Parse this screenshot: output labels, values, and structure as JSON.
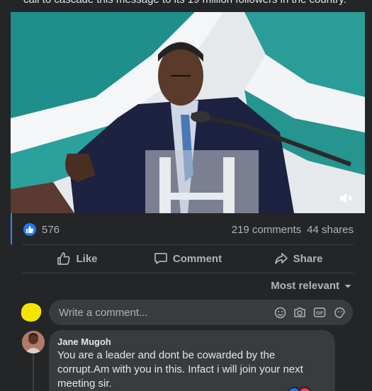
{
  "post": {
    "caption": "call to cascade this message to its 19 million followers in the country."
  },
  "stats": {
    "likes": "576",
    "comments": "219 comments",
    "shares": "44 shares"
  },
  "actions": {
    "like": "Like",
    "comment": "Comment",
    "share": "Share"
  },
  "sort": {
    "label": "Most relevant"
  },
  "composer": {
    "placeholder": "Write a comment..."
  },
  "comments": [
    {
      "author": "Jane Mugoh",
      "text": "You are a leader and dont be cowarded by the corrupt.Am with you in this. Infact i will join your next meeting sir."
    }
  ],
  "colors": {
    "background": "#242526",
    "bubble": "#3a3b3c",
    "accent": "#2078f4",
    "text": "#e4e6eb",
    "muted": "#b0b3b8"
  }
}
